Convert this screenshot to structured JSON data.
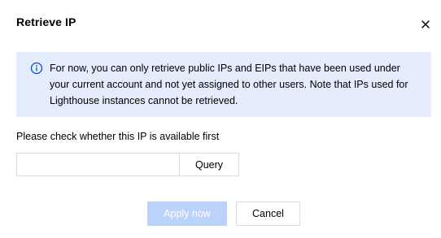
{
  "dialog": {
    "title": "Retrieve IP",
    "close_icon": "close-icon"
  },
  "notice": {
    "icon": "info-circle-icon",
    "text": "For now, you can only retrieve public IPs and EIPs that have been used under your current account and not yet assigned to other users. Note that IPs used for Lighthouse instances cannot be retrieved."
  },
  "check": {
    "label": "Please check whether this IP is available first",
    "input_value": "",
    "input_placeholder": "",
    "query_label": "Query"
  },
  "footer": {
    "apply_label": "Apply now",
    "cancel_label": "Cancel"
  },
  "colors": {
    "notice_bg": "#e5ecfc",
    "info_icon": "#0052d9",
    "apply_disabled_bg": "#bbd3fb",
    "border": "#dcdcdc"
  }
}
